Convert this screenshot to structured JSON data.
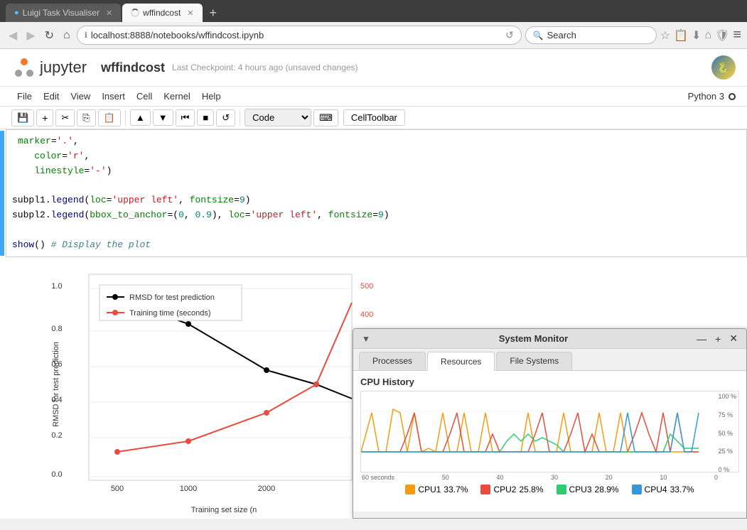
{
  "browser": {
    "tabs": [
      {
        "id": "tab1",
        "label": "Luigi Task Visualiser",
        "active": false,
        "icon": "🔵"
      },
      {
        "id": "tab2",
        "label": "wffindcost",
        "active": true,
        "icon": "🔄"
      }
    ],
    "new_tab_label": "+",
    "address": "localhost:8888/notebooks/wffindcost.ipynb",
    "search_placeholder": "Search",
    "nav_icons": [
      "◀",
      "▶",
      "↻",
      "🏠"
    ],
    "toolbar_icons": [
      "☆",
      "📋",
      "⬇",
      "🏠",
      "🛡",
      "≡"
    ]
  },
  "jupyter": {
    "logo_text": "jupyter",
    "notebook_name": "wffindcost",
    "checkpoint_text": "Last Checkpoint: 4 hours ago (unsaved changes)",
    "kernel": "Python 3",
    "menu": [
      "File",
      "Edit",
      "View",
      "Insert",
      "Cell",
      "Kernel",
      "Help"
    ],
    "toolbar": {
      "save": "💾",
      "add": "+",
      "cut": "✂",
      "copy": "⎘",
      "paste": "📋",
      "move_up": "▲",
      "move_down": "▼",
      "fast_forward": "⏮",
      "stop": "■",
      "restart": "↺",
      "cell_type": "Code",
      "keyboard": "⌨",
      "celltoolbar": "CellToolbar"
    },
    "code_lines": [
      {
        "text": "marker='.',",
        "type": "code"
      },
      {
        "text": "color='r',",
        "type": "code"
      },
      {
        "text": "linestyle='-')",
        "type": "code"
      },
      {
        "text": "",
        "type": "blank"
      },
      {
        "text": "subpl1.legend(loc='upper left', fontsize=9)",
        "type": "code"
      },
      {
        "text": "subpl2.legend(bbox_to_anchor=(0, 0.9), loc='upper left', fontsize=9)",
        "type": "code"
      },
      {
        "text": "",
        "type": "blank"
      },
      {
        "text": "show() # Display the plot",
        "type": "code"
      }
    ]
  },
  "system_monitor": {
    "title": "System Monitor",
    "tabs": [
      "Processes",
      "Resources",
      "File Systems"
    ],
    "active_tab": "Resources",
    "section_title": "CPU History",
    "time_labels": [
      "60 seconds",
      "50",
      "40",
      "30",
      "20",
      "10",
      "0"
    ],
    "pct_labels": [
      "100 %",
      "75 %",
      "50 %",
      "25 %",
      "0 %"
    ],
    "legend": [
      {
        "label": "CPU1",
        "value": "33.7%",
        "color": "#f39c12"
      },
      {
        "label": "CPU2",
        "value": "25.8%",
        "color": "#e74c3c"
      },
      {
        "label": "CPU3",
        "value": "28.9%",
        "color": "#2ecc71"
      },
      {
        "label": "CPU4",
        "value": "33.7%",
        "color": "#3498db"
      }
    ],
    "controls": {
      "minimize": "—",
      "maximize": "+",
      "close": "✕"
    }
  }
}
